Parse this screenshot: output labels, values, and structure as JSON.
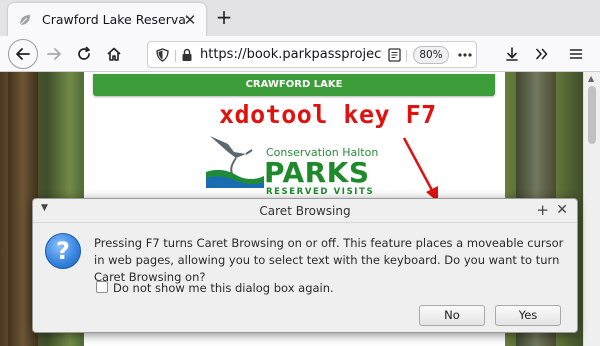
{
  "browser": {
    "tab": {
      "title": "Crawford Lake Reservation",
      "favicon": "leaf-icon"
    },
    "new_tab_label": "+",
    "url": "https://book.parkpassproject.com/",
    "zoom": "80%",
    "toolbar_icons": [
      "back-icon",
      "forward-icon",
      "reload-icon",
      "home-icon",
      "shield-icon",
      "lock-icon",
      "reader-view-icon",
      "more-icon",
      "download-icon",
      "overflow-icon",
      "menu-icon"
    ]
  },
  "page": {
    "banner": "CRAWFORD LAKE",
    "annotation": "xdotool key F7",
    "annotation_color": "#e0110f",
    "logo": {
      "line1": "Conservation Halton",
      "line2": "PARKS",
      "line3": "RESERVED VISITS"
    }
  },
  "dialog": {
    "title": "Caret Browsing",
    "message": "Pressing F7 turns Caret Browsing on or off. This feature places a moveable cursor in web pages, allowing you to select text with the keyboard. Do you want to turn Caret Browsing on?",
    "checkbox_label": "Do not show me this dialog box again.",
    "checkbox_checked": false,
    "no_label": "No",
    "yes_label": "Yes",
    "icon": "question-icon"
  }
}
